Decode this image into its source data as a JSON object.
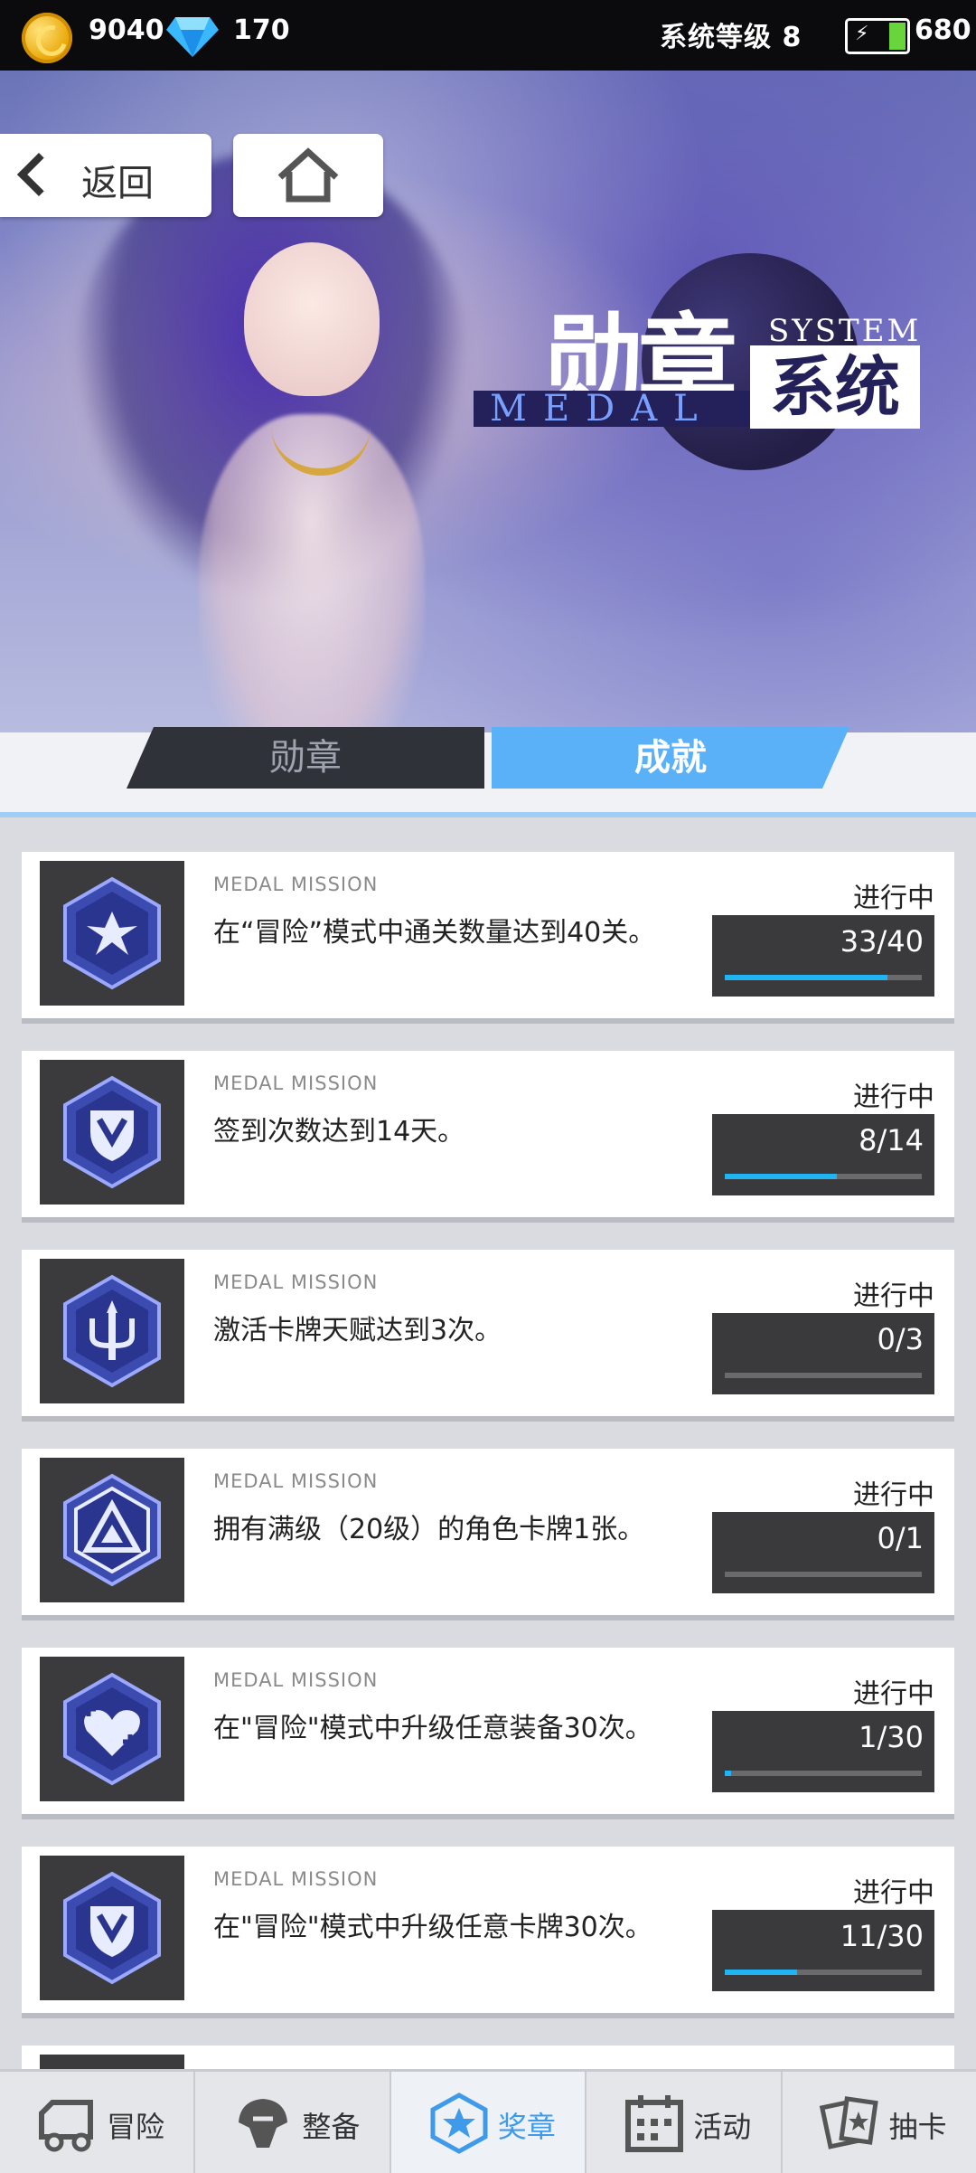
{
  "topbar": {
    "coins": "9040",
    "gems": "170",
    "system_level": "系统等级 8",
    "energy": "680",
    "icons": {
      "coin": "coin-icon",
      "gem": "diamond-icon",
      "battery": "battery-icon"
    }
  },
  "header": {
    "back_label": "返回",
    "home_icon": "home-icon"
  },
  "banner": {
    "title_cn": "勋章",
    "title_en": "MEDAL",
    "subtitle_en": "SYSTEM",
    "subtitle_cn": "系统"
  },
  "tabs": [
    {
      "label": "勋章",
      "active": false
    },
    {
      "label": "成就",
      "active": true
    }
  ],
  "colors": {
    "accent": "#5ab1f7",
    "progress": "#21b4f3",
    "dark_panel": "#3a3a3c"
  },
  "missions": [
    {
      "tag": "MEDAL MISSION",
      "text": "在“冒险”模式中通关数量达到40关。",
      "status": "进行中",
      "progress": "33/40",
      "fraction": 0.825,
      "icon": "shuriken-medal-icon"
    },
    {
      "tag": "MEDAL MISSION",
      "text": "签到次数达到14天。",
      "status": "进行中",
      "progress": "8/14",
      "fraction": 0.571,
      "icon": "shield-medal-icon"
    },
    {
      "tag": "MEDAL MISSION",
      "text": "激活卡牌天赋达到3次。",
      "status": "进行中",
      "progress": "0/3",
      "fraction": 0,
      "icon": "trident-medal-icon"
    },
    {
      "tag": "MEDAL MISSION",
      "text": "拥有满级（20级）的角色卡牌1张。",
      "status": "进行中",
      "progress": "0/1",
      "fraction": 0,
      "icon": "triangle-medal-icon"
    },
    {
      "tag": "MEDAL MISSION",
      "text": "在\"冒险\"模式中升级任意装备30次。",
      "status": "进行中",
      "progress": "1/30",
      "fraction": 0.033,
      "icon": "heart-plus-medal-icon"
    },
    {
      "tag": "MEDAL MISSION",
      "text": "在\"冒险\"模式中升级任意卡牌30次。",
      "status": "进行中",
      "progress": "11/30",
      "fraction": 0.367,
      "icon": "shield-medal-icon"
    }
  ],
  "bottom_nav": [
    {
      "label": "冒险",
      "icon": "truck-icon",
      "active": false
    },
    {
      "label": "整备",
      "icon": "helmet-icon",
      "active": false
    },
    {
      "label": "奖章",
      "icon": "star-badge-icon",
      "active": true
    },
    {
      "label": "活动",
      "icon": "calendar-icon",
      "active": false
    },
    {
      "label": "抽卡",
      "icon": "cards-icon",
      "active": false
    }
  ]
}
